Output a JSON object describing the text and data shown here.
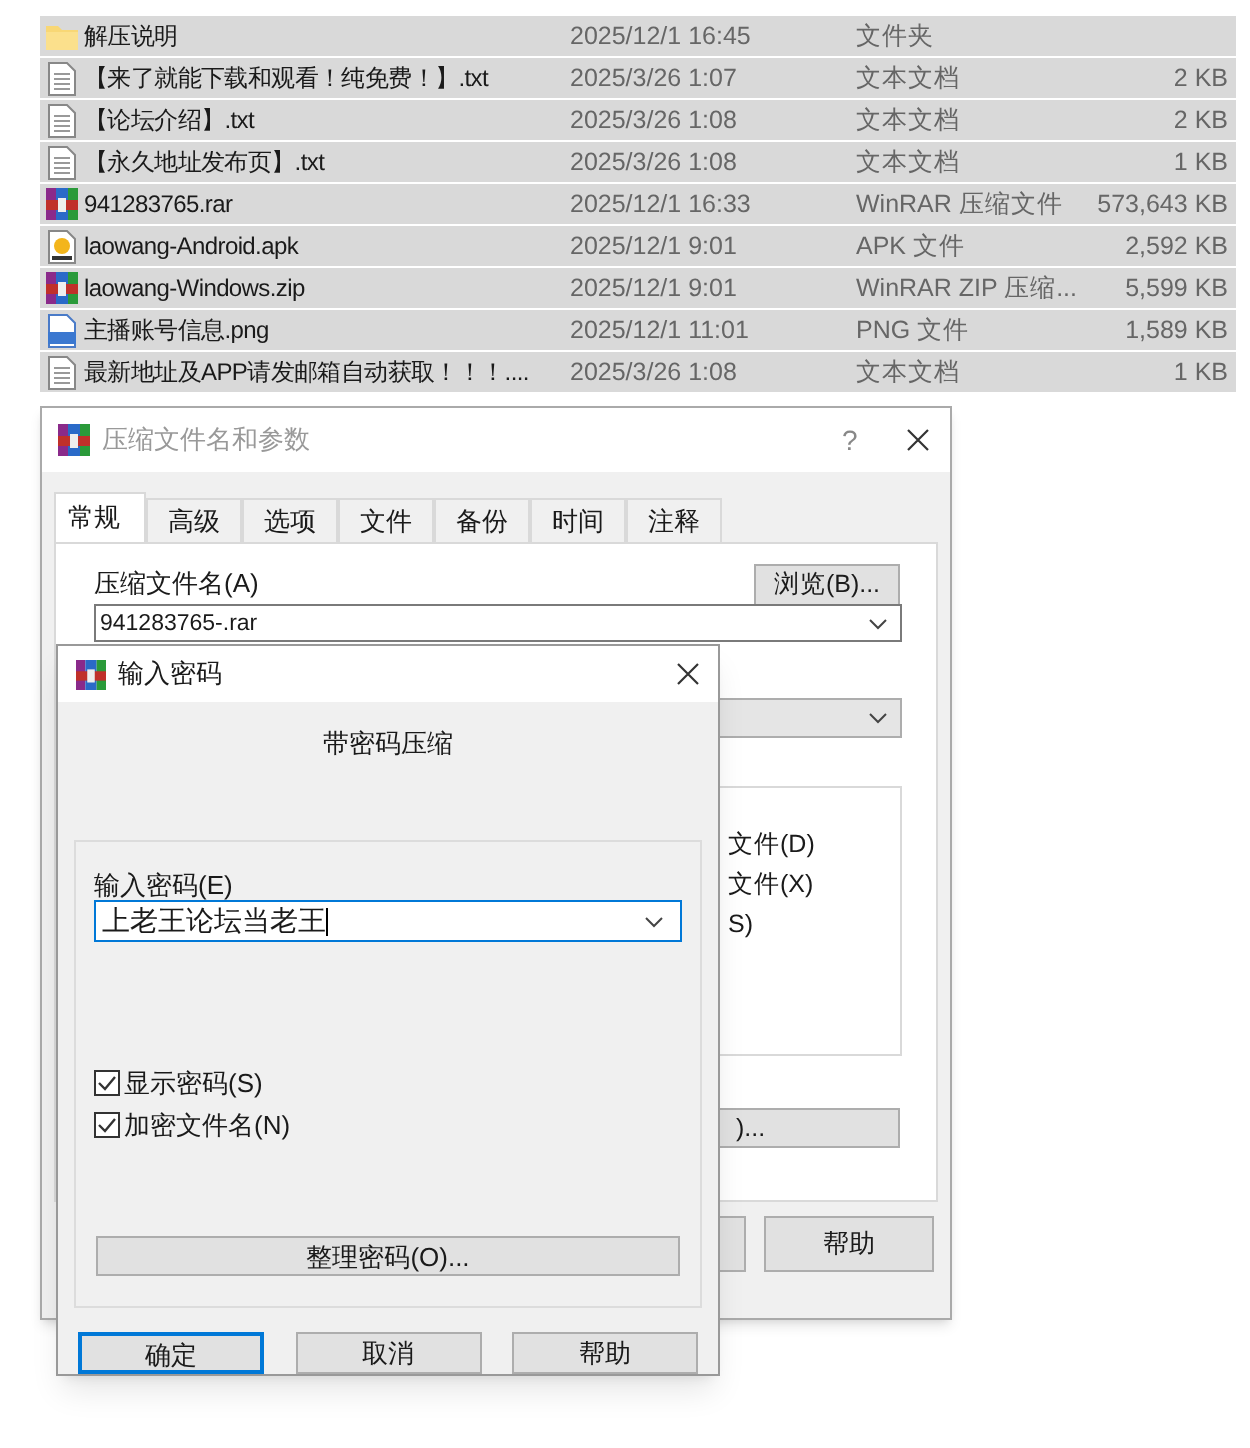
{
  "file_list": {
    "rows": [
      {
        "kind": "folder",
        "name": "解压说明",
        "modified": "2025/12/1 16:45",
        "type": "文件夹",
        "size": ""
      },
      {
        "kind": "text",
        "name": "【来了就能下载和观看！纯免费！】.txt",
        "modified": "2025/3/26 1:07",
        "type": "文本文档",
        "size": "2 KB"
      },
      {
        "kind": "text",
        "name": "【论坛介绍】.txt",
        "modified": "2025/3/26 1:08",
        "type": "文本文档",
        "size": "2 KB"
      },
      {
        "kind": "text",
        "name": "【永久地址发布页】.txt",
        "modified": "2025/3/26 1:08",
        "type": "文本文档",
        "size": "1 KB"
      },
      {
        "kind": "archive",
        "name": "941283765.rar",
        "modified": "2025/12/1 16:33",
        "type": "WinRAR 压缩文件",
        "size": "573,643 KB"
      },
      {
        "kind": "apk",
        "name": "laowang-Android.apk",
        "modified": "2025/12/1 9:01",
        "type": "APK 文件",
        "size": "2,592 KB"
      },
      {
        "kind": "archive",
        "name": "laowang-Windows.zip",
        "modified": "2025/12/1 9:01",
        "type": "WinRAR ZIP 压缩...",
        "size": "5,599 KB"
      },
      {
        "kind": "image",
        "name": "主播账号信息.png",
        "modified": "2025/12/1 11:01",
        "type": "PNG 文件",
        "size": "1,589 KB"
      },
      {
        "kind": "text",
        "name": "最新地址及APP请发邮箱自动获取！！！....",
        "modified": "2025/3/26 1:08",
        "type": "文本文档",
        "size": "1 KB"
      }
    ]
  },
  "archive_dialog": {
    "title": "压缩文件名和参数",
    "help_glyph": "?",
    "tabs": [
      {
        "label": "常规",
        "selected": true
      },
      {
        "label": "高级",
        "selected": false
      },
      {
        "label": "选项",
        "selected": false
      },
      {
        "label": "文件",
        "selected": false
      },
      {
        "label": "备份",
        "selected": false
      },
      {
        "label": "时间",
        "selected": false
      },
      {
        "label": "注释",
        "selected": false
      }
    ],
    "archive_name_label": "压缩文件名(A)",
    "browse_button": "浏览(B)...",
    "archive_name_value": "941283765-.rar",
    "partial_options": [
      "文件(D)",
      "文件(X)",
      "S)"
    ],
    "partial_button": ")...",
    "help_button": "帮助"
  },
  "password_dialog": {
    "title": "输入密码",
    "heading": "带密码压缩",
    "password_label": "输入密码(E)",
    "password_value": "上老王论坛当老王",
    "options": [
      {
        "label": "显示密码(S)",
        "checked": true
      },
      {
        "label": "加密文件名(N)",
        "checked": true
      }
    ],
    "organize_button": "整理密码(O)...",
    "buttons": [
      {
        "label": "确定",
        "selected": true
      },
      {
        "label": "取消",
        "selected": false
      },
      {
        "label": "帮助",
        "selected": false
      }
    ]
  }
}
